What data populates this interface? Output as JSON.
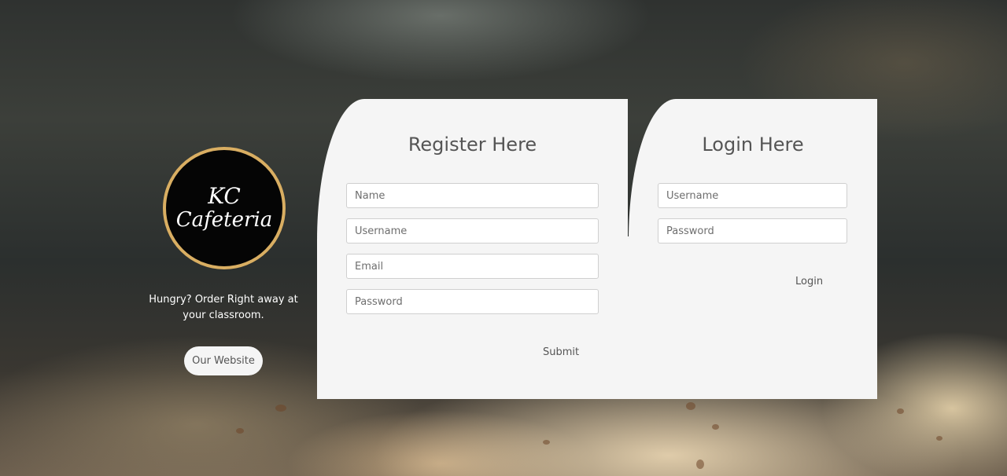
{
  "brand": {
    "logo_line1": "KC",
    "logo_line2": "Cafeteria",
    "tagline": "Hungry? Order Right away at your classroom.",
    "website_button": "Our Website"
  },
  "register": {
    "title": "Register Here",
    "name_placeholder": "Name",
    "username_placeholder": "Username",
    "email_placeholder": "Email",
    "password_placeholder": "Password",
    "submit_label": "Submit"
  },
  "login": {
    "title": "Login Here",
    "username_placeholder": "Username",
    "password_placeholder": "Password",
    "login_label": "Login"
  },
  "colors": {
    "card_bg": "#f5f5f5",
    "logo_ring": "#d9ae62",
    "text_gray": "#555555"
  }
}
